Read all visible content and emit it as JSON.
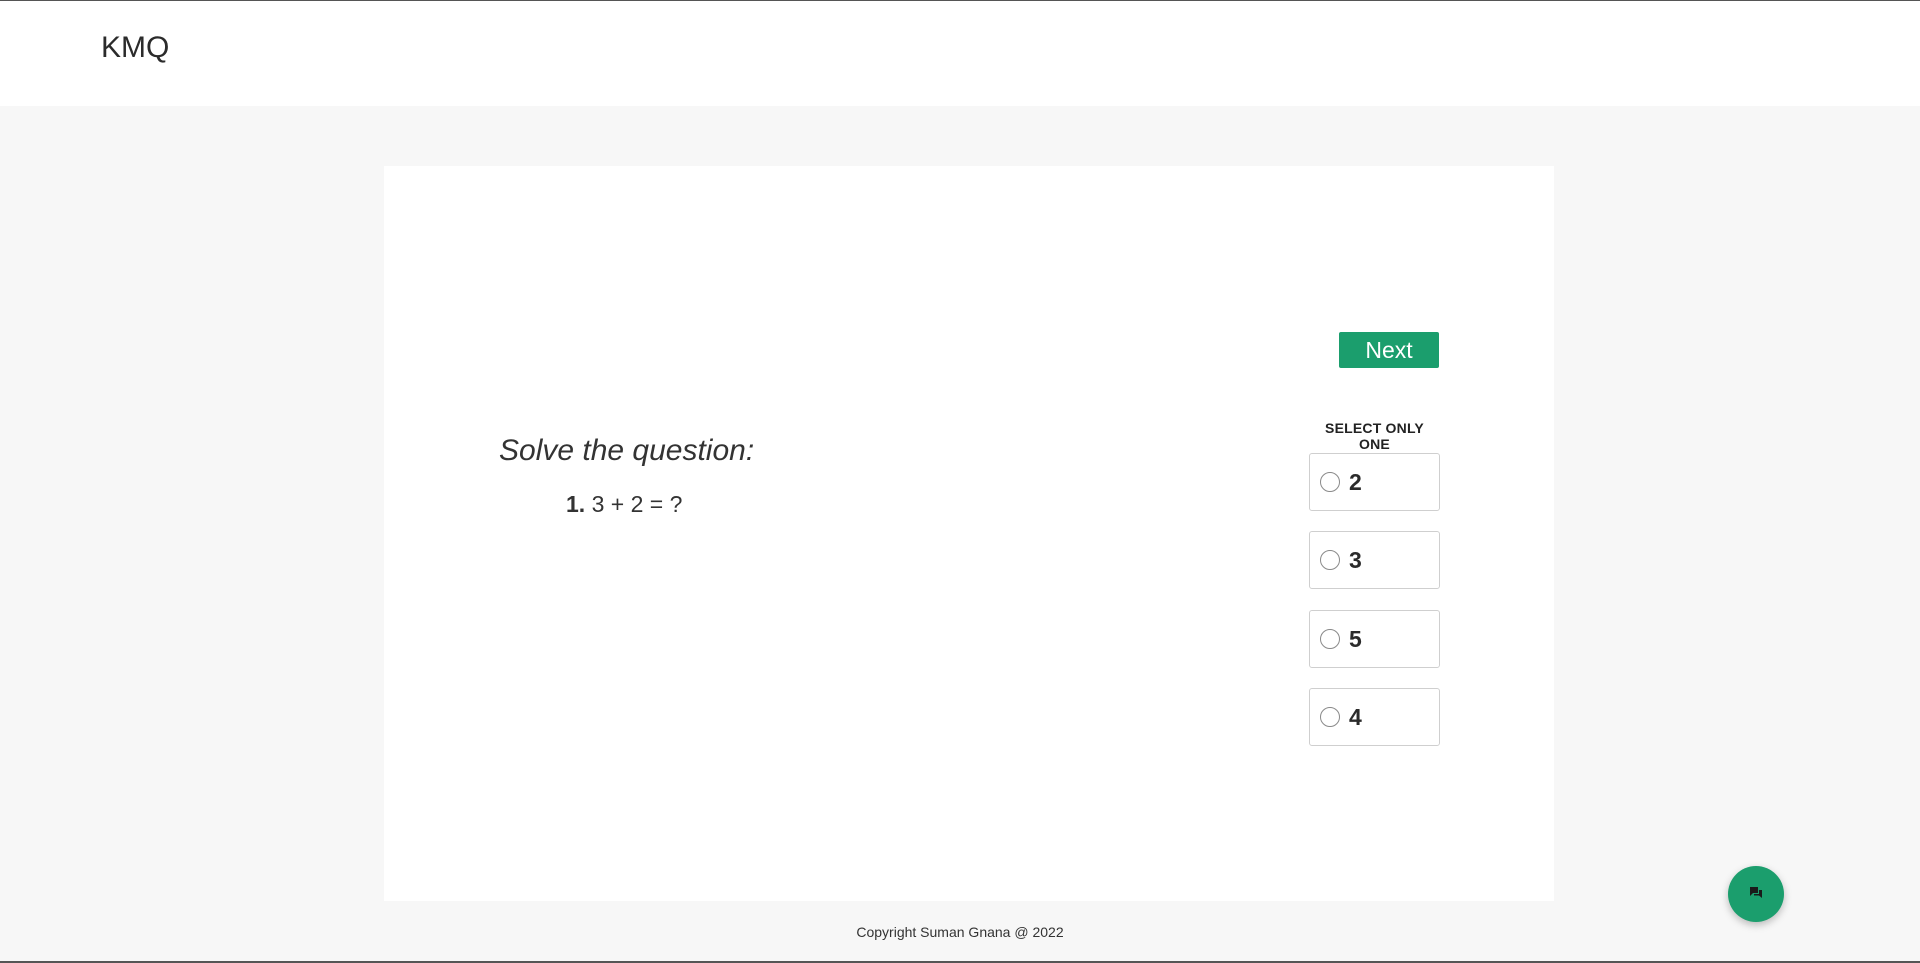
{
  "header": {
    "brand": "KMQ"
  },
  "quiz": {
    "next_label": "Next",
    "prompt": "Solve the question:",
    "question_number": "1.",
    "question_text": " 3 + 2 = ?",
    "select_label": "SELECT ONLY ONE",
    "options": [
      {
        "label": "2",
        "selected": false
      },
      {
        "label": "3",
        "selected": false
      },
      {
        "label": "5",
        "selected": false
      },
      {
        "label": "4",
        "selected": false
      }
    ]
  },
  "footer": {
    "copyright": "Copyright Suman Gnana @ 2022"
  },
  "chat": {
    "icon": "chat-bubbles-icon"
  },
  "colors": {
    "accent": "#1b9e6d",
    "page_background": "#f7f7f7",
    "card_background": "#ffffff"
  }
}
